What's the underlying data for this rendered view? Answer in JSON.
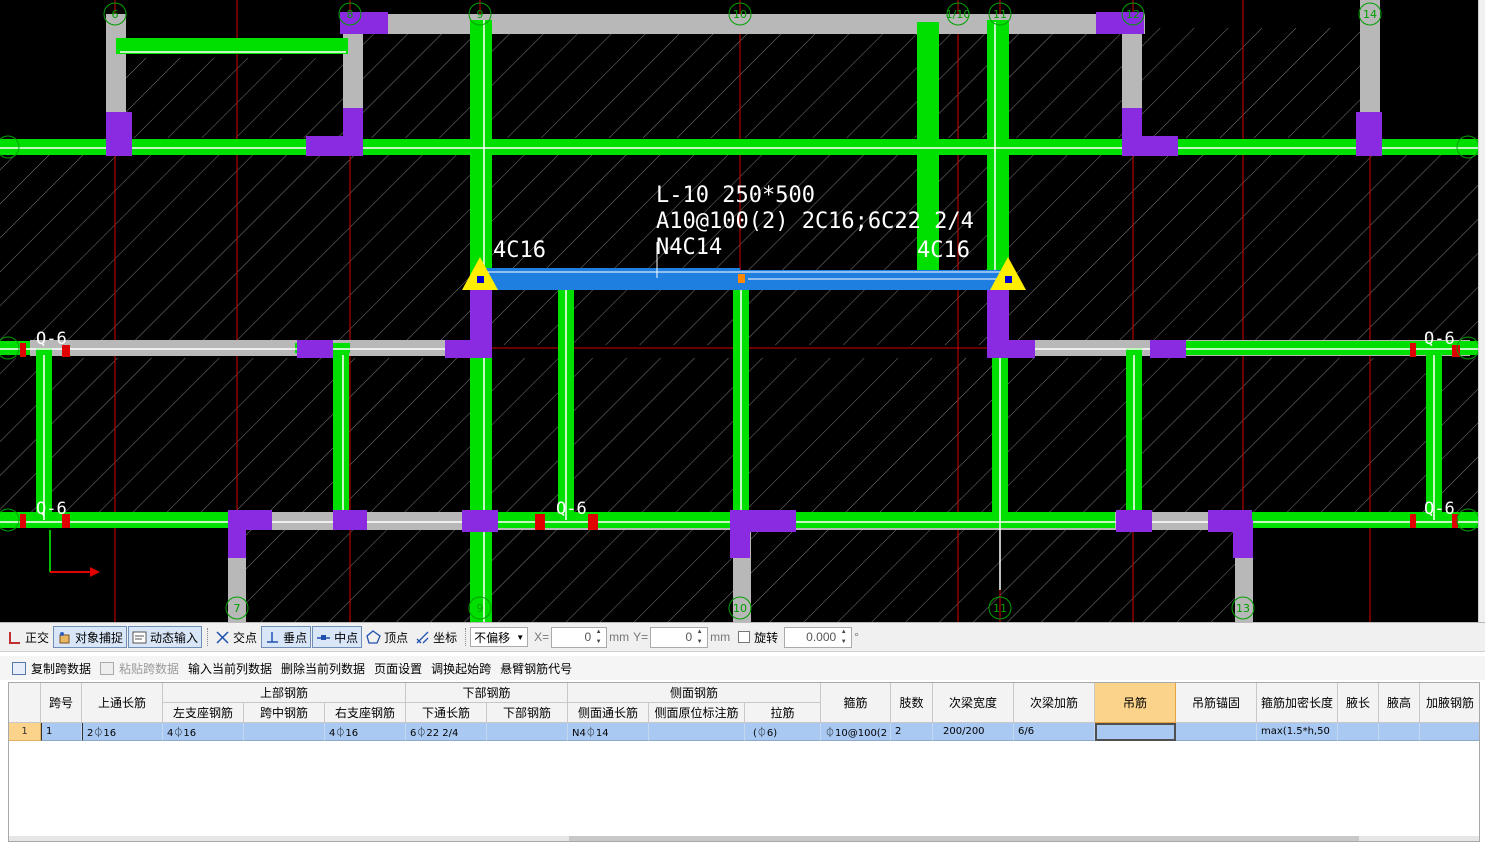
{
  "drawing": {
    "annotation": {
      "line1": "L-10 250*500",
      "line2": "A10@100(2) 2C16;6C22 2/4",
      "line3": "N4C14"
    },
    "left_support": "4C16",
    "right_support": "4C16",
    "beam_labels": [
      "Q-6",
      "Q-6",
      "Q-6",
      "Q-6",
      "Q-6"
    ],
    "axis_top": [
      "6",
      "8",
      "9",
      "10",
      "1/10",
      "11",
      "12",
      "14"
    ],
    "axis_bottom": [
      "7",
      "9",
      "10",
      "11",
      "13"
    ],
    "colors": {
      "background": "#000000",
      "beam_green": "#00e000",
      "column_purple": "#8a2be2",
      "wall_gray": "#b8b8b8",
      "selected_blue": "#1e7fe0",
      "grid_red": "#e00000",
      "support_yellow": "#ffee00"
    }
  },
  "snapbar": {
    "ortho": "正交",
    "object_snap": "对象捕捉",
    "dynamic_input": "动态输入",
    "intersection": "交点",
    "perpendicular": "垂点",
    "midpoint": "中点",
    "vertex": "顶点",
    "coordinate": "坐标",
    "offset_mode": "不偏移",
    "x_label": "X=",
    "x_value": "0",
    "y_label": "Y=",
    "y_value": "0",
    "unit": "mm",
    "rotate": "旋转",
    "rotate_value": "0.000",
    "degree": "°"
  },
  "actions": {
    "copy_span": "复制跨数据",
    "paste_span": "粘贴跨数据",
    "input_column": "输入当前列数据",
    "delete_column": "删除当前列数据",
    "page_setup": "页面设置",
    "adjust_start": "调换起始跨",
    "cantilever_code": "悬臂钢筋代号"
  },
  "table": {
    "headers": {
      "span_no": "跨号",
      "top_through": "上通长筋",
      "top_group": "上部钢筋",
      "left_support": "左支座钢筋",
      "mid_span": "跨中钢筋",
      "right_support": "右支座钢筋",
      "bottom_group": "下部钢筋",
      "bottom_through": "下通长筋",
      "bottom": "下部钢筋",
      "side_group": "侧面钢筋",
      "side_through": "侧面通长筋",
      "side_original": "侧面原位标注筋",
      "tie": "拉筋",
      "stirrup": "箍筋",
      "legs": "肢数",
      "secondary_width": "次梁宽度",
      "secondary_add": "次梁加筋",
      "hanger": "吊筋",
      "hanger_anchor": "吊筋锚固",
      "stirrup_dense": "箍筋加密长度",
      "haunch_len": "腋长",
      "haunch_height": "腋高",
      "haunch_bar": "加腋钢筋"
    },
    "row": {
      "row_no": "1",
      "span_no": "1",
      "top_through": "2⏀16",
      "left_support": "4⏀16",
      "mid_span": "",
      "right_support": "4⏀16",
      "bottom_through": "6⏀22 2/4",
      "bottom": "",
      "side_through": "N4⏀14",
      "side_original": "",
      "tie": "(⏀6)",
      "stirrup": "⏀10@100(2",
      "legs": "2",
      "secondary_width": "200/200",
      "secondary_add": "6/6",
      "hanger": "",
      "hanger_anchor": "",
      "stirrup_dense": "max(1.5*h,50",
      "haunch_len": "",
      "haunch_height": "",
      "haunch_bar": ""
    }
  }
}
